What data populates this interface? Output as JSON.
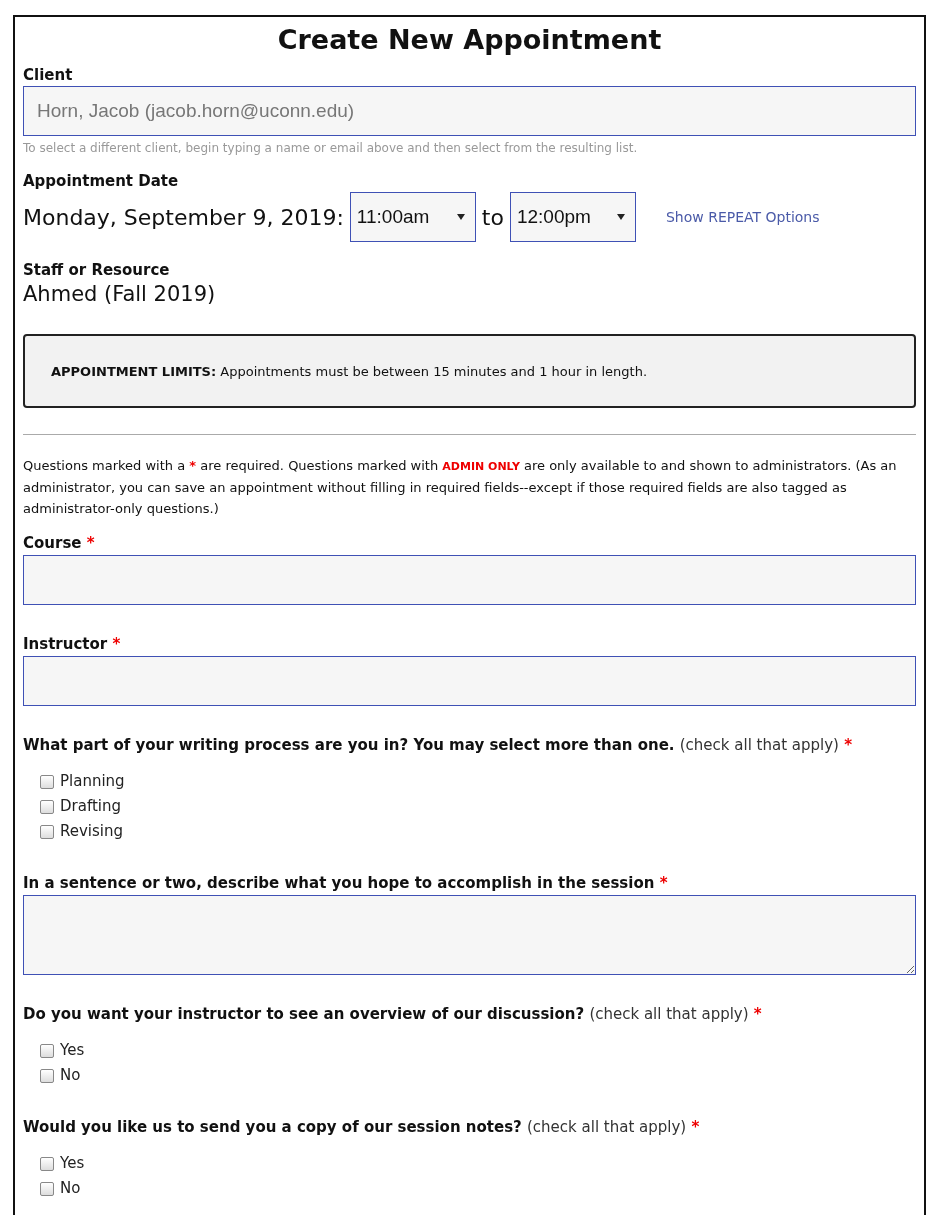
{
  "title": "Create New Appointment",
  "client": {
    "label": "Client",
    "value": "Horn, Jacob (jacob.horn@uconn.edu)",
    "hint": "To select a different client, begin typing a name or email above and then select from the resulting list."
  },
  "appointment_date": {
    "label": "Appointment Date",
    "date": "Monday, September 9, 2019:",
    "start": "11:00am",
    "separator": "to",
    "end": "12:00pm",
    "repeat_link": "Show REPEAT Options"
  },
  "staff": {
    "label": "Staff or Resource",
    "value": "Ahmed (Fall 2019)"
  },
  "limits": {
    "label": "APPOINTMENT LIMITS:",
    "text": "Appointments must be between 15 minutes and 1 hour in length."
  },
  "notice": {
    "before": "Questions marked with a",
    "required_mark": "*",
    "middle": "are required. Questions marked with",
    "admin_tag": "ADMIN ONLY",
    "after": "are only available to and shown to administrators. (As an administrator, you can save an appointment without filling in required fields--except if those required fields are also tagged as administrator-only questions.)"
  },
  "questions": [
    {
      "kind": "text",
      "label": "Course",
      "required_mark": "*"
    },
    {
      "kind": "text",
      "label": "Instructor",
      "required_mark": "*"
    },
    {
      "kind": "checkboxes",
      "label": "What part of your writing process are you in? You may select more than one.",
      "hint": "(check all that apply)",
      "required_mark": "*",
      "options": [
        {
          "label": "Planning",
          "checked": false
        },
        {
          "label": "Drafting",
          "checked": false
        },
        {
          "label": "Revising",
          "checked": false
        }
      ]
    },
    {
      "kind": "textarea",
      "label": "In a sentence or two, describe what you hope to accomplish in the session",
      "required_mark": "*"
    },
    {
      "kind": "checkboxes",
      "label": "Do you want your instructor to see an overview of our discussion?",
      "hint": "(check all that apply)",
      "required_mark": "*",
      "options": [
        {
          "label": "Yes",
          "checked": false
        },
        {
          "label": "No",
          "checked": false
        }
      ]
    },
    {
      "kind": "checkboxes",
      "label": "Would you like us to send you a copy of our session notes?",
      "hint": "(check all that apply)",
      "required_mark": "*",
      "options": [
        {
          "label": "Yes",
          "checked": false
        },
        {
          "label": "No",
          "checked": false
        }
      ]
    }
  ]
}
